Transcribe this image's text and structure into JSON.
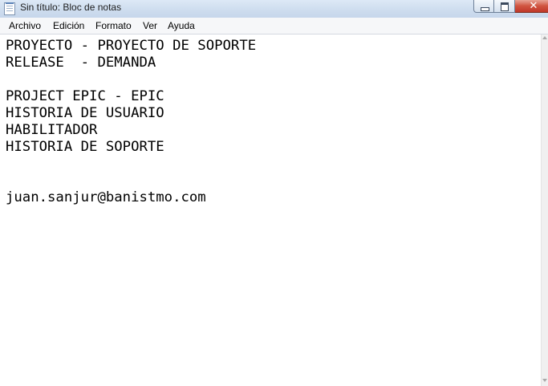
{
  "window": {
    "title": "Sin título: Bloc de notas"
  },
  "menu": {
    "items": [
      {
        "label": "Archivo"
      },
      {
        "label": "Edición"
      },
      {
        "label": "Formato"
      },
      {
        "label": "Ver"
      },
      {
        "label": "Ayuda"
      }
    ]
  },
  "caption_buttons": {
    "close_glyph": "✕"
  },
  "editor": {
    "lines": [
      "PROYECTO - PROYECTO DE SOPORTE",
      "RELEASE  - DEMANDA",
      "",
      "PROJECT EPIC - EPIC",
      "HISTORIA DE USUARIO",
      "HABILITADOR",
      "HISTORIA DE SOPORTE",
      "",
      "",
      "juan.sanjur@banistmo.com"
    ]
  },
  "icons": {
    "app": "notepad-icon",
    "minimize": "minimize-icon",
    "maximize": "maximize-icon",
    "close": "close-icon",
    "scroll_up": "chevron-up-icon",
    "scroll_down": "chevron-down-icon"
  },
  "colors": {
    "titlebar": "#cddcee",
    "close_button": "#c0382a",
    "menubar": "#f6f7f9",
    "editor_bg": "#ffffff",
    "text": "#000000"
  }
}
